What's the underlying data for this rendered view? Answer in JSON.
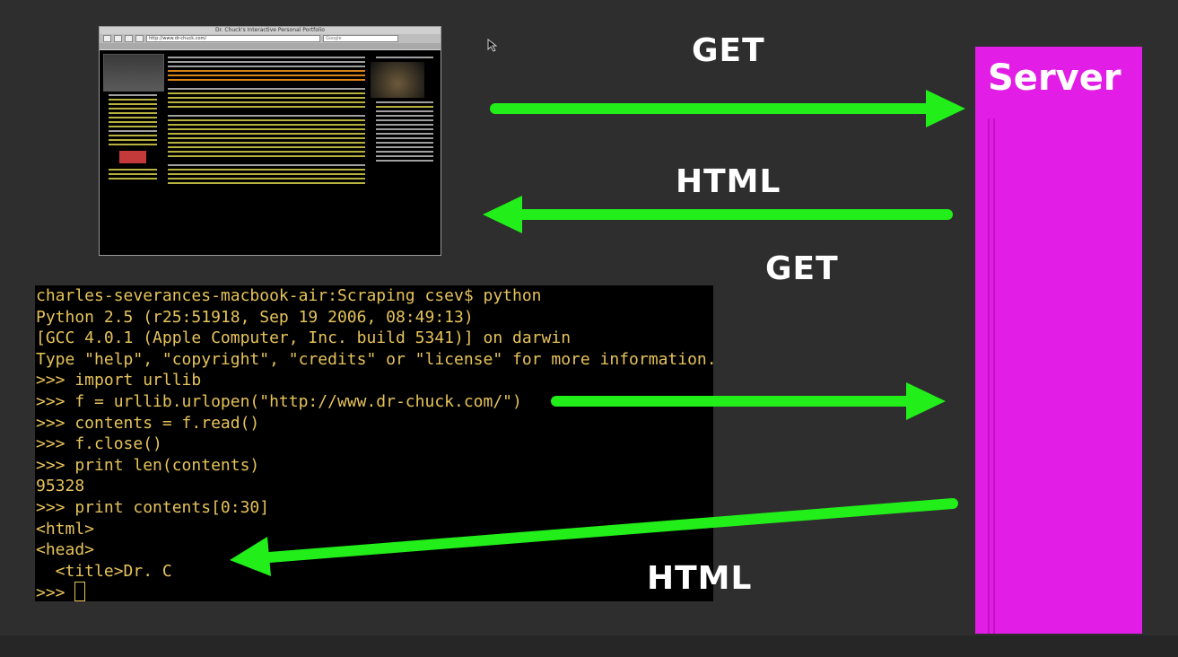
{
  "labels": {
    "get_top": "GET",
    "html_top": "HTML",
    "get_bottom": "GET",
    "html_bottom": "HTML",
    "server": "Server"
  },
  "browser": {
    "window_title": "Dr. Chuck's Interactive Personal Portfolio",
    "url": "http://www.dr-chuck.com/",
    "search_placeholder": "Google"
  },
  "terminal": {
    "lines": [
      "charles-severances-macbook-air:Scraping csev$ python",
      "Python 2.5 (r25:51918, Sep 19 2006, 08:49:13)",
      "[GCC 4.0.1 (Apple Computer, Inc. build 5341)] on darwin",
      "Type \"help\", \"copyright\", \"credits\" or \"license\" for more information.",
      ">>> import urllib",
      ">>> f = urllib.urlopen(\"http://www.dr-chuck.com/\")",
      ">>> contents = f.read()",
      ">>> f.close()",
      ">>> print len(contents)",
      "95328",
      ">>> print contents[0:30]",
      "<html>",
      "<head>",
      "  <title>Dr. C",
      ">>> "
    ]
  },
  "colors": {
    "background": "#2e2e2e",
    "arrow": "#22ee1a",
    "server": "#e11de6",
    "terminal_text": "#e6c35a"
  }
}
